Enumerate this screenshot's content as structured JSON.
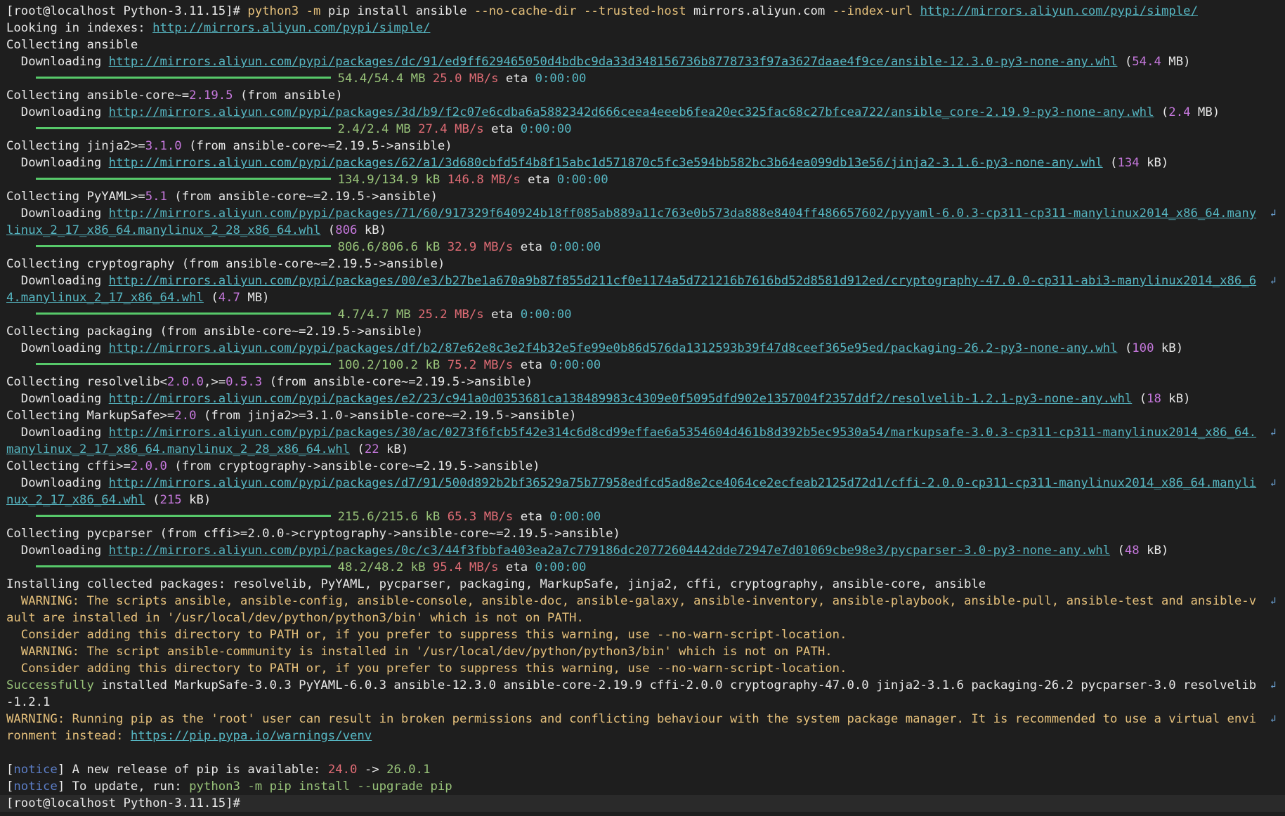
{
  "terminal": {
    "lines": [
      {
        "segs": [
          [
            "[root@localhost Python-3.11.15]# ",
            "d"
          ],
          [
            "python3",
            "y"
          ],
          [
            " -m ",
            "y"
          ],
          [
            "pip install ansible ",
            "d"
          ],
          [
            "--no-cache-dir",
            "y"
          ],
          [
            " ",
            "d"
          ],
          [
            "--trusted-host",
            "y"
          ],
          [
            " mirrors.aliyun.com ",
            "d"
          ],
          [
            "--index-url",
            "y"
          ],
          [
            " ",
            "d"
          ],
          [
            "http://mirrors.aliyun.com/pypi/simple/",
            "u"
          ]
        ]
      },
      {
        "segs": [
          [
            "Looking in indexes: ",
            "d"
          ],
          [
            "http://mirrors.aliyun.com/pypi/simple/",
            "u"
          ]
        ]
      },
      {
        "segs": [
          [
            "Collecting ansible",
            "d"
          ]
        ]
      },
      {
        "segs": [
          [
            "  Downloading ",
            "d"
          ],
          [
            "http://mirrors.aliyun.com/pypi/packages/dc/91/ed9ff629465050d4bdbc9da33d348156736b8778733f97a3627daae4f9ce/ansible-12.3.0-py3-none-any.whl",
            "u"
          ],
          [
            " (",
            "d"
          ],
          [
            "54.4",
            "m"
          ],
          [
            " MB)",
            "d"
          ]
        ]
      },
      {
        "bar": true,
        "segs": [
          [
            "54.4/54.4 MB ",
            "s"
          ],
          [
            "25.0 MB/s",
            "r"
          ],
          [
            " eta ",
            "d"
          ],
          [
            "0:00:00",
            "c"
          ]
        ]
      },
      {
        "segs": [
          [
            "Collecting ansible-core~=",
            "d"
          ],
          [
            "2.19.5",
            "m"
          ],
          [
            " (from ansible)",
            "d"
          ]
        ]
      },
      {
        "segs": [
          [
            "  Downloading ",
            "d"
          ],
          [
            "http://mirrors.aliyun.com/pypi/packages/3d/b9/f2c07e6cdba6a5882342d666ceea4eeeb6fea20ec325fac68c27bfcea722/ansible_core-2.19.9-py3-none-any.whl",
            "u"
          ],
          [
            " (",
            "d"
          ],
          [
            "2.4",
            "m"
          ],
          [
            " MB)",
            "d"
          ]
        ]
      },
      {
        "bar": true,
        "segs": [
          [
            "2.4/2.4 MB ",
            "s"
          ],
          [
            "27.4 MB/s",
            "r"
          ],
          [
            " eta ",
            "d"
          ],
          [
            "0:00:00",
            "c"
          ]
        ]
      },
      {
        "segs": [
          [
            "Collecting jinja2>=",
            "d"
          ],
          [
            "3.1.0",
            "m"
          ],
          [
            " (from ansible-core~=2.19.5->ansible)",
            "d"
          ]
        ]
      },
      {
        "segs": [
          [
            "  Downloading ",
            "d"
          ],
          [
            "http://mirrors.aliyun.com/pypi/packages/62/a1/3d680cbfd5f4b8f15abc1d571870c5fc3e594bb582bc3b64ea099db13e56/jinja2-3.1.6-py3-none-any.whl",
            "u"
          ],
          [
            " (",
            "d"
          ],
          [
            "134",
            "m"
          ],
          [
            " kB)",
            "d"
          ]
        ]
      },
      {
        "bar": true,
        "segs": [
          [
            "134.9/134.9 kB ",
            "s"
          ],
          [
            "146.8 MB/s",
            "r"
          ],
          [
            " eta ",
            "d"
          ],
          [
            "0:00:00",
            "c"
          ]
        ]
      },
      {
        "segs": [
          [
            "Collecting PyYAML>=",
            "d"
          ],
          [
            "5.1",
            "m"
          ],
          [
            " (from ansible-core~=2.19.5->ansible)",
            "d"
          ]
        ]
      },
      {
        "wrap": true,
        "segs": [
          [
            "  Downloading ",
            "d"
          ],
          [
            "http://mirrors.aliyun.com/pypi/packages/71/60/917329f640924b18ff085ab889a11c763e0b573da888e8404ff486657602/pyyaml-6.0.3-cp311-cp311-manylinux2014_x86_64.many",
            "u"
          ]
        ]
      },
      {
        "segs": [
          [
            "linux_2_17_x86_64.manylinux_2_28_x86_64.whl",
            "u"
          ],
          [
            " (",
            "d"
          ],
          [
            "806",
            "m"
          ],
          [
            " kB)",
            "d"
          ]
        ]
      },
      {
        "bar": true,
        "segs": [
          [
            "806.6/806.6 kB ",
            "s"
          ],
          [
            "32.9 MB/s",
            "r"
          ],
          [
            " eta ",
            "d"
          ],
          [
            "0:00:00",
            "c"
          ]
        ]
      },
      {
        "segs": [
          [
            "Collecting cryptography (from ansible-core~=2.19.5->ansible)",
            "d"
          ]
        ]
      },
      {
        "wrap": true,
        "segs": [
          [
            "  Downloading ",
            "d"
          ],
          [
            "http://mirrors.aliyun.com/pypi/packages/00/e3/b27be1a670a9b87f855d211cf0e1174a5d721216b7616bd52d8581d912ed/cryptography-47.0.0-cp311-abi3-manylinux2014_x86_6",
            "u"
          ]
        ]
      },
      {
        "segs": [
          [
            "4.manylinux_2_17_x86_64.whl",
            "u"
          ],
          [
            " (",
            "d"
          ],
          [
            "4.7",
            "m"
          ],
          [
            " MB)",
            "d"
          ]
        ]
      },
      {
        "bar": true,
        "segs": [
          [
            "4.7/4.7 MB ",
            "s"
          ],
          [
            "25.2 MB/s",
            "r"
          ],
          [
            " eta ",
            "d"
          ],
          [
            "0:00:00",
            "c"
          ]
        ]
      },
      {
        "segs": [
          [
            "Collecting packaging (from ansible-core~=2.19.5->ansible)",
            "d"
          ]
        ]
      },
      {
        "segs": [
          [
            "  Downloading ",
            "d"
          ],
          [
            "http://mirrors.aliyun.com/pypi/packages/df/b2/87e62e8c3e2f4b32e5fe99e0b86d576da1312593b39f47d8ceef365e95ed/packaging-26.2-py3-none-any.whl",
            "u"
          ],
          [
            " (",
            "d"
          ],
          [
            "100",
            "m"
          ],
          [
            " kB)",
            "d"
          ]
        ]
      },
      {
        "bar": true,
        "segs": [
          [
            "100.2/100.2 kB ",
            "s"
          ],
          [
            "75.2 MB/s",
            "r"
          ],
          [
            " eta ",
            "d"
          ],
          [
            "0:00:00",
            "c"
          ]
        ]
      },
      {
        "segs": [
          [
            "Collecting resolvelib<",
            "d"
          ],
          [
            "2.0.0",
            "m"
          ],
          [
            ",>=",
            "d"
          ],
          [
            "0.5.3",
            "m"
          ],
          [
            " (from ansible-core~=2.19.5->ansible)",
            "d"
          ]
        ]
      },
      {
        "segs": [
          [
            "  Downloading ",
            "d"
          ],
          [
            "http://mirrors.aliyun.com/pypi/packages/e2/23/c941a0d0353681ca138489983c4309e0f5095dfd902e1357004f2357ddf2/resolvelib-1.2.1-py3-none-any.whl",
            "u"
          ],
          [
            " (",
            "d"
          ],
          [
            "18",
            "m"
          ],
          [
            " kB)",
            "d"
          ]
        ]
      },
      {
        "segs": [
          [
            "Collecting MarkupSafe>=",
            "d"
          ],
          [
            "2.0",
            "m"
          ],
          [
            " (from jinja2>=3.1.0->ansible-core~=2.19.5->ansible)",
            "d"
          ]
        ]
      },
      {
        "wrap": true,
        "segs": [
          [
            "  Downloading ",
            "d"
          ],
          [
            "http://mirrors.aliyun.com/pypi/packages/30/ac/0273f6fcb5f42e314c6d8cd99effae6a5354604d461b8d392b5ec9530a54/markupsafe-3.0.3-cp311-cp311-manylinux2014_x86_64.",
            "u"
          ]
        ]
      },
      {
        "segs": [
          [
            "manylinux_2_17_x86_64.manylinux_2_28_x86_64.whl",
            "u"
          ],
          [
            " (",
            "d"
          ],
          [
            "22",
            "m"
          ],
          [
            " kB)",
            "d"
          ]
        ]
      },
      {
        "segs": [
          [
            "Collecting cffi>=",
            "d"
          ],
          [
            "2.0.0",
            "m"
          ],
          [
            " (from cryptography->ansible-core~=2.19.5->ansible)",
            "d"
          ]
        ]
      },
      {
        "wrap": true,
        "segs": [
          [
            "  Downloading ",
            "d"
          ],
          [
            "http://mirrors.aliyun.com/pypi/packages/d7/91/500d892b2bf36529a75b77958edfcd5ad8e2ce4064ce2ecfeab2125d72d1/cffi-2.0.0-cp311-cp311-manylinux2014_x86_64.manyli",
            "u"
          ]
        ]
      },
      {
        "segs": [
          [
            "nux_2_17_x86_64.whl",
            "u"
          ],
          [
            " (",
            "d"
          ],
          [
            "215",
            "m"
          ],
          [
            " kB)",
            "d"
          ]
        ]
      },
      {
        "bar": true,
        "segs": [
          [
            "215.6/215.6 kB ",
            "s"
          ],
          [
            "65.3 MB/s",
            "r"
          ],
          [
            " eta ",
            "d"
          ],
          [
            "0:00:00",
            "c"
          ]
        ]
      },
      {
        "segs": [
          [
            "Collecting pycparser (from cffi>=2.0.0->cryptography->ansible-core~=2.19.5->ansible)",
            "d"
          ]
        ]
      },
      {
        "segs": [
          [
            "  Downloading ",
            "d"
          ],
          [
            "http://mirrors.aliyun.com/pypi/packages/0c/c3/44f3fbbfa403ea2a7c779186dc20772604442dde72947e7d01069cbe98e3/pycparser-3.0-py3-none-any.whl",
            "u"
          ],
          [
            " (",
            "d"
          ],
          [
            "48",
            "m"
          ],
          [
            " kB)",
            "d"
          ]
        ]
      },
      {
        "bar": true,
        "segs": [
          [
            "48.2/48.2 kB ",
            "s"
          ],
          [
            "95.4 MB/s",
            "r"
          ],
          [
            " eta ",
            "d"
          ],
          [
            "0:00:00",
            "c"
          ]
        ]
      },
      {
        "segs": [
          [
            "Installing collected packages: resolvelib, PyYAML, pycparser, packaging, MarkupSafe, jinja2, cffi, cryptography, ansible-core, ansible",
            "d"
          ]
        ]
      },
      {
        "wrap": true,
        "segs": [
          [
            "  WARNING: The scripts ansible, ansible-config, ansible-console, ansible-doc, ansible-galaxy, ansible-inventory, ansible-playbook, ansible-pull, ansible-test and ansible-v",
            "y"
          ]
        ]
      },
      {
        "segs": [
          [
            "ault are installed in '/usr/local/dev/python/python3/bin' which is not on PATH.",
            "y"
          ]
        ]
      },
      {
        "segs": [
          [
            "  Consider adding this directory to PATH or, if you prefer to suppress this warning, use --no-warn-script-location.",
            "y"
          ]
        ]
      },
      {
        "segs": [
          [
            "  WARNING: The script ansible-community is installed in '/usr/local/dev/python/python3/bin' which is not on PATH.",
            "y"
          ]
        ]
      },
      {
        "segs": [
          [
            "  Consider adding this directory to PATH or, if you prefer to suppress this warning, use --no-warn-script-location.",
            "y"
          ]
        ]
      },
      {
        "wrap": true,
        "segs": [
          [
            "Successfully",
            "s"
          ],
          [
            " installed MarkupSafe-3.0.3 PyYAML-6.0.3 ansible-12.3.0 ansible-core-2.19.9 cffi-2.0.0 cryptography-47.0.0 jinja2-3.1.6 packaging-26.2 pycparser-3.0 resolvelib",
            "d"
          ]
        ]
      },
      {
        "segs": [
          [
            "-1.2.1",
            "d"
          ]
        ]
      },
      {
        "wrap": true,
        "segs": [
          [
            "WARNING: Running pip as the 'root' user can result in broken permissions and conflicting behaviour with the system package manager. It is recommended to use a virtual envi",
            "y"
          ]
        ]
      },
      {
        "segs": [
          [
            "ronment instead: ",
            "y"
          ],
          [
            "https://pip.pypa.io/warnings/venv",
            "u"
          ]
        ]
      },
      {
        "segs": []
      },
      {
        "segs": [
          [
            "[",
            "d"
          ],
          [
            "notice",
            "n"
          ],
          [
            "] A new release of pip is available: ",
            "d"
          ],
          [
            "24.0",
            "r"
          ],
          [
            " -> ",
            "d"
          ],
          [
            "26.0.1",
            "s"
          ]
        ]
      },
      {
        "segs": [
          [
            "[",
            "d"
          ],
          [
            "notice",
            "n"
          ],
          [
            "] To update, run: ",
            "d"
          ],
          [
            "python3 -m pip install --upgrade pip",
            "s"
          ]
        ]
      },
      {
        "cursor": true,
        "segs": [
          [
            "[root@localhost Python-3.11.15]# ",
            "d"
          ]
        ]
      }
    ],
    "wrap_glyph": "↲"
  }
}
